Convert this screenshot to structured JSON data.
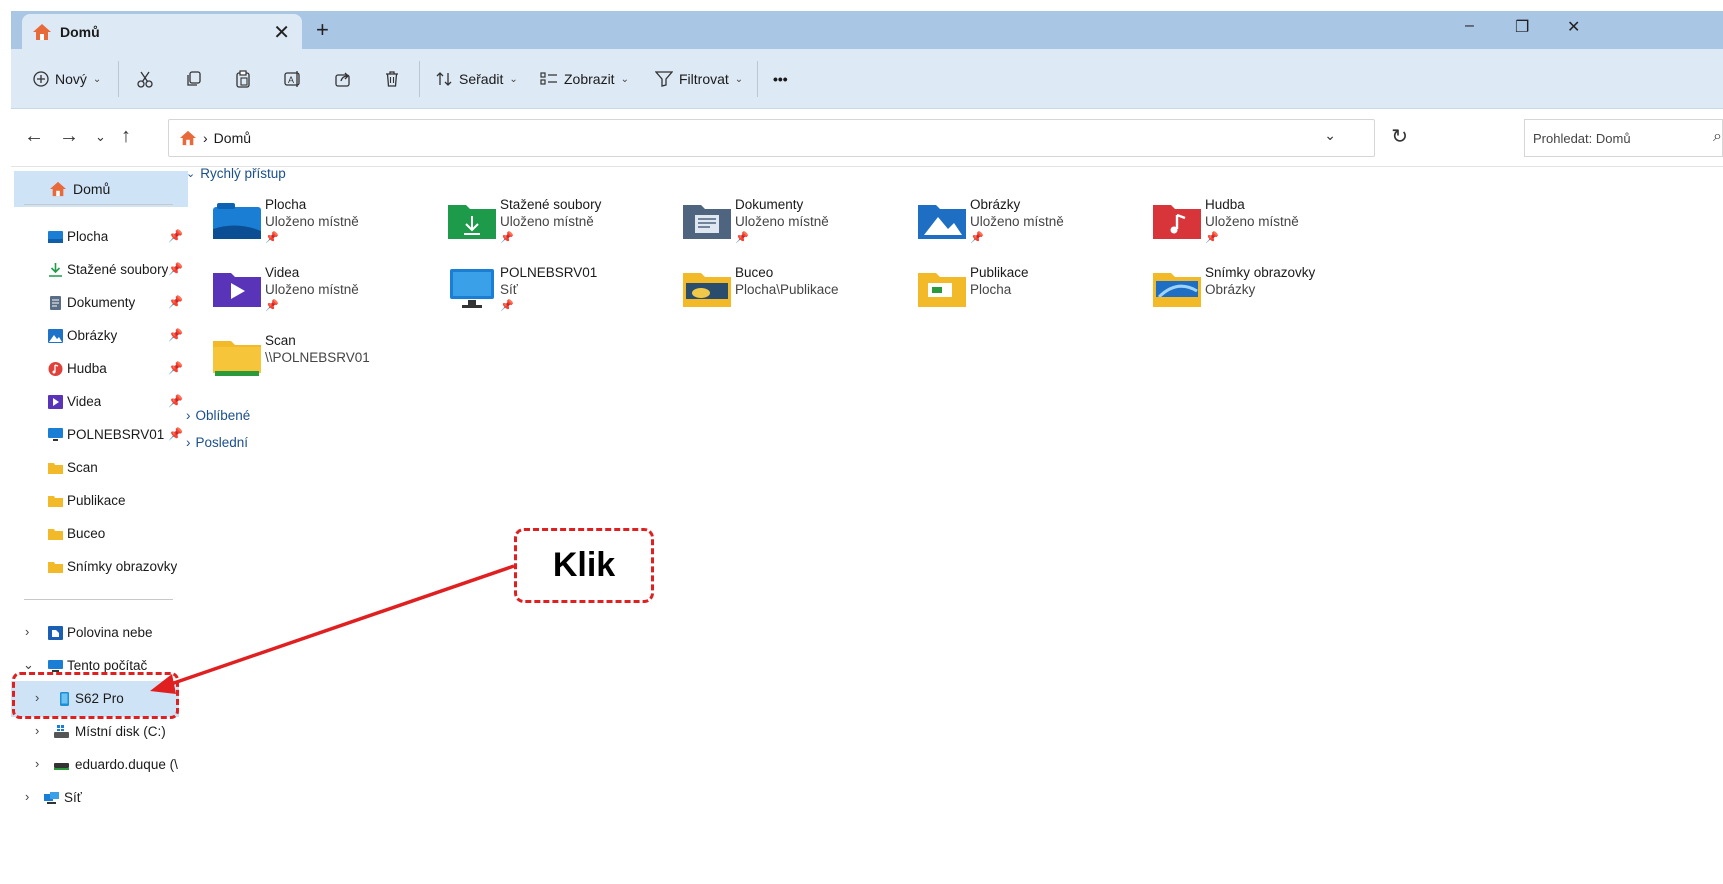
{
  "tab": {
    "title": "Domů",
    "close": "✕",
    "new": "+"
  },
  "window_controls": {
    "minimize": "–",
    "restore": "❐",
    "close": "✕"
  },
  "toolbar": {
    "new_label": "Nový",
    "sort_label": "Seřadit",
    "view_label": "Zobrazit",
    "filter_label": "Filtrovat",
    "more_label": "•••"
  },
  "address": {
    "path": "Domů",
    "search_placeholder": "Prohledat: Domů"
  },
  "sidebar": {
    "home": "Domů",
    "pinned": [
      {
        "label": "Plocha",
        "icon": "desktop-icon",
        "color": "#1a7fd4",
        "pinned": true
      },
      {
        "label": "Stažené soubory",
        "icon": "download-icon",
        "color": "#1e9b4a",
        "pinned": true
      },
      {
        "label": "Dokumenty",
        "icon": "documents-icon",
        "color": "#5a6d86",
        "pinned": true
      },
      {
        "label": "Obrázky",
        "icon": "pictures-icon",
        "color": "#1e72c8",
        "pinned": true
      },
      {
        "label": "Hudba",
        "icon": "music-icon",
        "color": "#e0413a",
        "pinned": true
      },
      {
        "label": "Videa",
        "icon": "videos-icon",
        "color": "#5a34b8",
        "pinned": true
      },
      {
        "label": "POLNEBSRV01",
        "icon": "monitor-icon",
        "color": "#1a7fd4",
        "pinned": true
      },
      {
        "label": "Scan",
        "icon": "folder-icon",
        "color": "#f2b928",
        "pinned": false
      },
      {
        "label": "Publikace",
        "icon": "folder-icon",
        "color": "#f2b928",
        "pinned": false
      },
      {
        "label": "Buceo",
        "icon": "folder-icon",
        "color": "#f2b928",
        "pinned": false
      },
      {
        "label": "Snímky obrazovky",
        "icon": "folder-icon",
        "color": "#f2b928",
        "pinned": false
      }
    ],
    "tree": [
      {
        "label": "Polovina nebe",
        "icon": "cloud-icon"
      },
      {
        "label": "Tento počítač",
        "icon": "this-pc-icon"
      },
      {
        "label": "S62 Pro",
        "icon": "phone-icon"
      },
      {
        "label": "Místní disk (C:)",
        "icon": "drive-icon"
      },
      {
        "label": "eduardo.duque (\\",
        "icon": "network-drive-icon"
      },
      {
        "label": "Síť",
        "icon": "network-icon"
      }
    ],
    "pin_glyph": "📌"
  },
  "main": {
    "quick_access_label": "Rychlý přístup",
    "favorites_label": "Oblíbené",
    "recent_label": "Poslední",
    "items": [
      {
        "name": "Plocha",
        "sub": "Uloženo místně",
        "pinned": true,
        "icon": "desktop-folder-icon"
      },
      {
        "name": "Stažené soubory",
        "sub": "Uloženo místně",
        "pinned": true,
        "icon": "downloads-folder-icon"
      },
      {
        "name": "Dokumenty",
        "sub": "Uloženo místně",
        "pinned": true,
        "icon": "documents-folder-icon"
      },
      {
        "name": "Obrázky",
        "sub": "Uloženo místně",
        "pinned": true,
        "icon": "pictures-folder-icon"
      },
      {
        "name": "Hudba",
        "sub": "Uloženo místně",
        "pinned": true,
        "icon": "music-folder-icon"
      },
      {
        "name": "Videa",
        "sub": "Uloženo místně",
        "pinned": true,
        "icon": "videos-folder-icon"
      },
      {
        "name": "POLNEBSRV01",
        "sub": "Síť",
        "pinned": true,
        "icon": "monitor-icon"
      },
      {
        "name": "Buceo",
        "sub": "Plocha\\Publikace",
        "pinned": false,
        "icon": "folder-icon"
      },
      {
        "name": "Publikace",
        "sub": "Plocha",
        "pinned": false,
        "icon": "folder-icon"
      },
      {
        "name": "Snímky obrazovky",
        "sub": "Obrázky",
        "pinned": false,
        "icon": "folder-icon"
      },
      {
        "name": "Scan",
        "sub": "\\\\POLNEBSRV01",
        "pinned": false,
        "icon": "folder-icon"
      }
    ]
  },
  "annotation": {
    "callout_text": "Klik",
    "color": "#e02020"
  }
}
